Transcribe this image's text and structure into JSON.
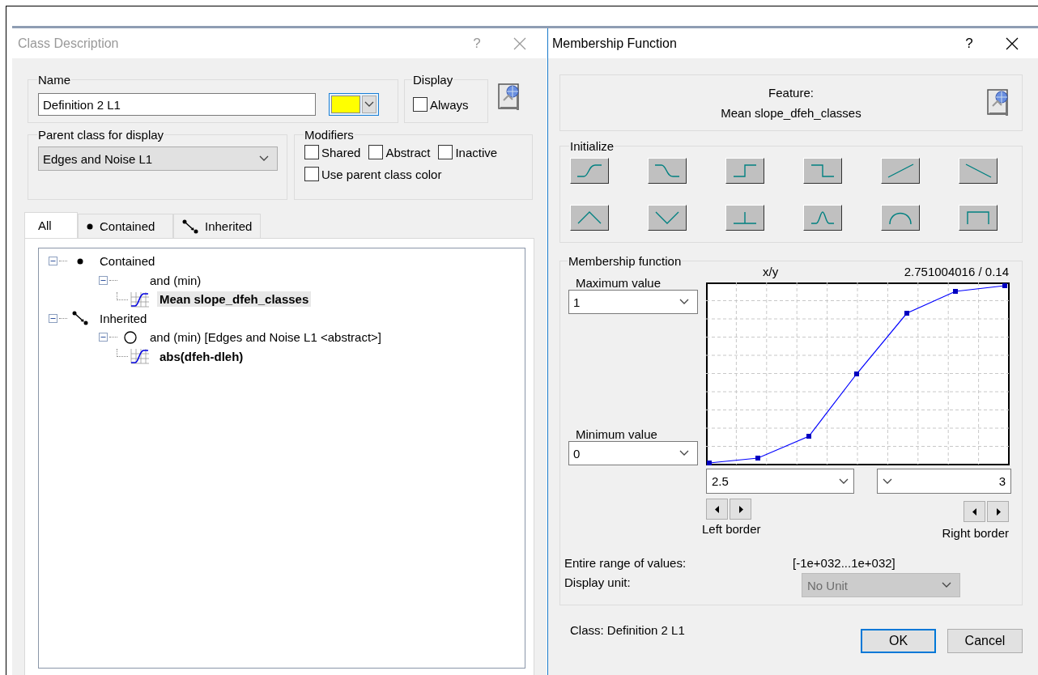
{
  "class_description": {
    "title": "Class Description",
    "help_button": "?",
    "name_group": {
      "label": "Name",
      "value": "Definition 2 L1",
      "color": "#ffff00"
    },
    "display_group": {
      "label": "Display",
      "checkboxes": [
        {
          "label": "Always",
          "checked": false
        }
      ]
    },
    "parent_group": {
      "label": "Parent class for display",
      "value": "Edges and Noise L1"
    },
    "modifiers": {
      "label": "Modifiers",
      "checkboxes": [
        {
          "label": "Shared",
          "checked": false
        },
        {
          "label": "Abstract",
          "checked": false
        },
        {
          "label": "Inactive",
          "checked": false
        },
        {
          "label": "Use parent class color",
          "checked": false
        }
      ]
    },
    "tabs": [
      {
        "label": "All",
        "kind": "plain",
        "selected": true
      },
      {
        "label": "Contained",
        "kind": "dot",
        "selected": false
      },
      {
        "label": "Inherited",
        "kind": "inherit",
        "selected": false
      }
    ],
    "tree": [
      {
        "label": "Contained",
        "kind": "dot",
        "expanded": true,
        "selected": false,
        "children": [
          {
            "label": "and (min)",
            "kind": "operator",
            "expanded": true,
            "selected": false,
            "children": [
              {
                "label": "Mean slope_dfeh_classes",
                "kind": "feature",
                "selected": true
              }
            ]
          }
        ]
      },
      {
        "label": "Inherited",
        "kind": "inherit",
        "expanded": true,
        "selected": false,
        "children": [
          {
            "label": "and (min) [Edges and Noise L1 <abstract>]",
            "kind": "circle",
            "expanded": true,
            "selected": false,
            "children": [
              {
                "label": "abs(dfeh-dleh)",
                "kind": "feature",
                "selected": false
              }
            ]
          }
        ]
      }
    ]
  },
  "membership_function": {
    "title": "Membership Function",
    "help_button": "?",
    "feature_label": "Feature:",
    "feature_name": "Mean slope_dfeh_classes",
    "initialize_label": "Initialize",
    "shapes": [
      {
        "kind": "s_rise"
      },
      {
        "kind": "s_fall"
      },
      {
        "kind": "step_up"
      },
      {
        "kind": "step_down"
      },
      {
        "kind": "linear_up"
      },
      {
        "kind": "linear_down"
      },
      {
        "kind": "triangle"
      },
      {
        "kind": "v"
      },
      {
        "kind": "single"
      },
      {
        "kind": "bell"
      },
      {
        "kind": "arc"
      },
      {
        "kind": "rect"
      }
    ],
    "function_group": {
      "label": "Membership function",
      "xy_label": "x/y",
      "xy_value": "2.751004016 / 0.14",
      "max_label": "Maximum value",
      "max_value": "1",
      "min_label": "Minimum value",
      "min_value": "0",
      "left_value": "2.5",
      "right_value": "3",
      "left_label": "Left border",
      "right_label": "Right border",
      "range_label": "Entire range of values:",
      "range_value": "[-1e+032...1e+032]",
      "unit_label": "Display unit:",
      "unit_value": "No Unit",
      "unit_disabled": true
    },
    "class_text": "Class: Definition 2 L1",
    "buttons": [
      {
        "label": "OK",
        "default": true
      },
      {
        "label": "Cancel",
        "default": false
      }
    ]
  }
}
